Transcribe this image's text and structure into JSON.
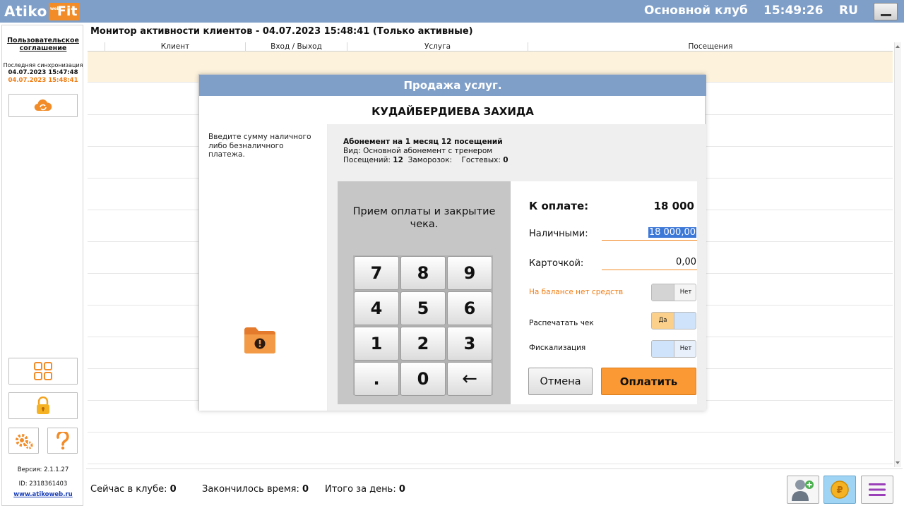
{
  "topbar": {
    "logo_main": "Atiko",
    "logo_badge": "Fit",
    "logo_badge_small": "web",
    "club": "Основной клуб",
    "time": "15:49:26",
    "lang": "RU"
  },
  "sidebar": {
    "agreement": "Пользовательское соглашение",
    "sync_label": "Последняя синхронизация",
    "sync_time_1": "04.07.2023 15:47:48",
    "sync_time_2": "04.07.2023 15:48:41",
    "version": "Версия: 2.1.1.27",
    "id": "ID: 2318361403",
    "website": "www.atikoweb.ru"
  },
  "monitor": {
    "title": "Монитор активности клиентов - 04.07.2023 15:48:41 (Только активные)",
    "columns": [
      "Клиент",
      "Вход / Выход",
      "Услуга",
      "Посещения"
    ]
  },
  "status": {
    "in_club_label": "Сейчас в клубе:",
    "in_club_value": "0",
    "expired_label": "Закончилось время:",
    "expired_value": "0",
    "total_label": "Итого за день:",
    "total_value": "0"
  },
  "modal": {
    "title": "Продажа услуг.",
    "client": "КУДАЙБЕРДИЕВА ЗАХИДА",
    "hint": "Введите сумму  наличного либо безналичного платежа.",
    "subscription": {
      "name": "Абонемент на 1 месяц  12 посещений",
      "kind": "Вид: Основной абонемент с тренером",
      "visits_label": "Посещений:",
      "visits": "12",
      "freezes_label": "Заморозок:",
      "freezes": "",
      "guests_label": "Гостевых:",
      "guests": "0"
    },
    "keypad_title": "Прием оплаты и закрытие чека.",
    "keys": [
      "7",
      "8",
      "9",
      "4",
      "5",
      "6",
      "1",
      "2",
      "3",
      ".",
      "0",
      "←"
    ],
    "to_pay_label": "К оплате:",
    "to_pay_value": "18 000",
    "cash_label": "Наличными:",
    "cash_value": "18 000,00",
    "card_label": "Карточкой:",
    "card_value": "0,00",
    "balance_label": "На балансе нет средств",
    "balance_toggle": "Нет",
    "print_label": "Распечатать чек",
    "print_toggle": "Да",
    "fiscal_label": "Фискализация",
    "fiscal_toggle": "Нет",
    "cancel_button": "Отмена",
    "pay_button": "Оплатить"
  },
  "colors": {
    "accent_blue": "#7f9fc9",
    "accent_orange": "#f28c28",
    "highlight_row": "#fdf3dd"
  },
  "icons": [
    "cloud-sync-icon",
    "grid-icon",
    "lock-icon",
    "settings-icon",
    "help-icon",
    "folder-alert-icon",
    "add-client-icon",
    "coin-icon",
    "menu-icon"
  ]
}
